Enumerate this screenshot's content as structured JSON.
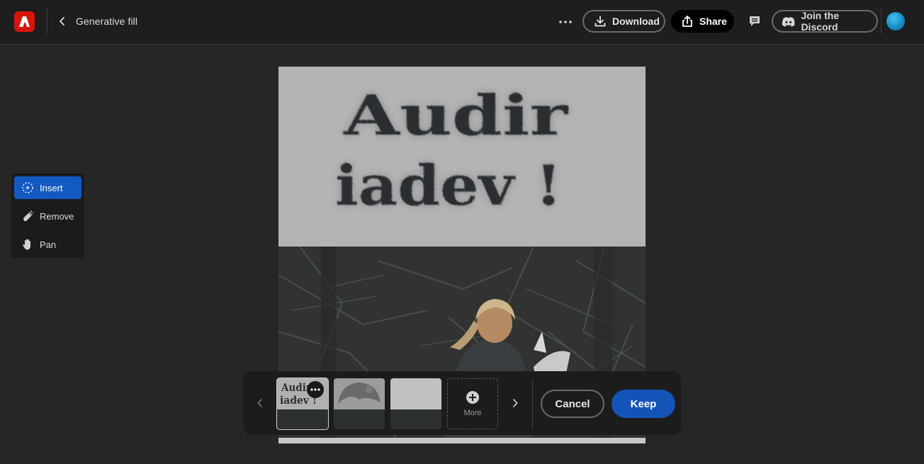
{
  "header": {
    "title": "Generative fill",
    "download_label": "Download",
    "share_label": "Share",
    "discord_label": "Join the Discord"
  },
  "tools": [
    {
      "label": "Insert",
      "icon": "sparkle-circle-icon",
      "active": true
    },
    {
      "label": "Remove",
      "icon": "eraser-icon",
      "active": false
    },
    {
      "label": "Pan",
      "icon": "hand-icon",
      "active": false
    }
  ],
  "canvas": {
    "generated_text": [
      "Audir",
      "iadev !"
    ]
  },
  "variations": {
    "more_label": "More",
    "selected_index": 0,
    "count": 3
  },
  "actions": {
    "cancel_label": "Cancel",
    "keep_label": "Keep"
  },
  "colors": {
    "accent": "#1354b8",
    "brand": "#d7150b"
  }
}
